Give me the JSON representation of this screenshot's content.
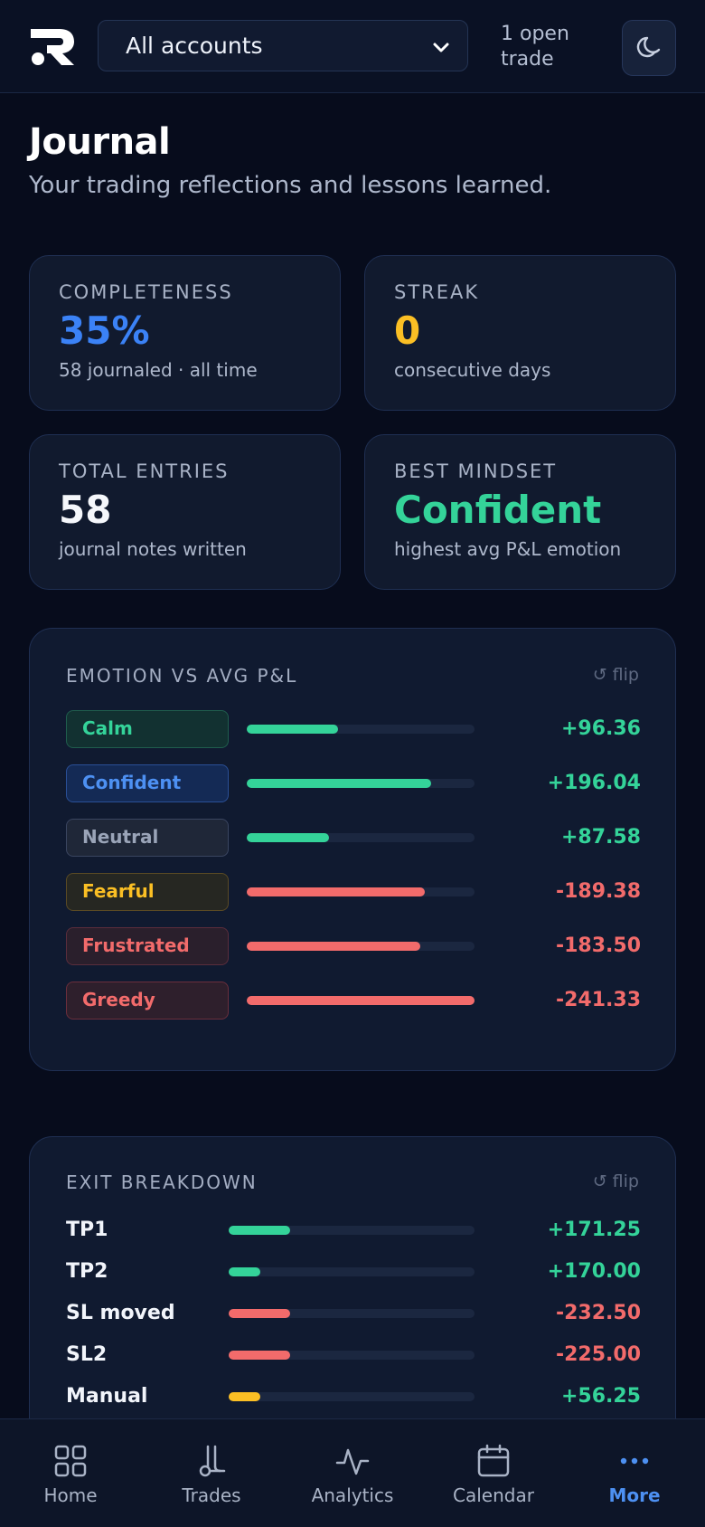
{
  "header": {
    "account_select": "All accounts",
    "open_trade": "1 open trade"
  },
  "page": {
    "title": "Journal",
    "subtitle": "Your trading reflections and lessons learned."
  },
  "stats": [
    {
      "label": "COMPLETENESS",
      "value": "35%",
      "sub": "58 journaled · all time",
      "color": "#3b82f6"
    },
    {
      "label": "STREAK",
      "value": "0",
      "sub": "consecutive days",
      "color": "#fbbf24"
    },
    {
      "label": "TOTAL ENTRIES",
      "value": "58",
      "sub": "journal notes written",
      "color": "#f5f7fb"
    },
    {
      "label": "BEST MINDSET",
      "value": "Confident",
      "sub": "highest avg P&L emotion",
      "color": "#34d399"
    }
  ],
  "emotion_panel": {
    "title": "EMOTION VS AVG P&L",
    "flip": "↺ flip",
    "rows": [
      {
        "emotion": "Calm",
        "value": "+96.36",
        "fill": 0.4,
        "tone": "calm"
      },
      {
        "emotion": "Confident",
        "value": "+196.04",
        "fill": 0.81,
        "tone": "confident"
      },
      {
        "emotion": "Neutral",
        "value": "+87.58",
        "fill": 0.36,
        "tone": "neutral"
      },
      {
        "emotion": "Fearful",
        "value": "-189.38",
        "fill": 0.78,
        "tone": "fearful"
      },
      {
        "emotion": "Frustrated",
        "value": "-183.50",
        "fill": 0.76,
        "tone": "frustrated"
      },
      {
        "emotion": "Greedy",
        "value": "-241.33",
        "fill": 1.0,
        "tone": "greedy"
      }
    ]
  },
  "exit_panel": {
    "title": "EXIT BREAKDOWN",
    "flip": "↺ flip",
    "rows": [
      {
        "label": "TP1",
        "value": "+171.25",
        "fill": 0.25,
        "color": "#34d399"
      },
      {
        "label": "TP2",
        "value": "+170.00",
        "fill": 0.13,
        "color": "#34d399"
      },
      {
        "label": "SL moved",
        "value": "-232.50",
        "fill": 0.25,
        "color": "#f26b6b"
      },
      {
        "label": "SL2",
        "value": "-225.00",
        "fill": 0.25,
        "color": "#f26b6b"
      },
      {
        "label": "Manual",
        "value": "+56.25",
        "fill": 0.13,
        "color": "#fbbf24"
      }
    ]
  },
  "nav": [
    {
      "label": "Home",
      "icon": "grid-icon"
    },
    {
      "label": "Trades",
      "icon": "trades-icon"
    },
    {
      "label": "Analytics",
      "icon": "pulse-icon"
    },
    {
      "label": "Calendar",
      "icon": "calendar-icon"
    },
    {
      "label": "More",
      "icon": "more-dots-icon"
    }
  ],
  "colors": {
    "positive": "#34d399",
    "negative": "#f26b6b",
    "accent": "#4d90f2",
    "warning": "#fbbf24"
  }
}
